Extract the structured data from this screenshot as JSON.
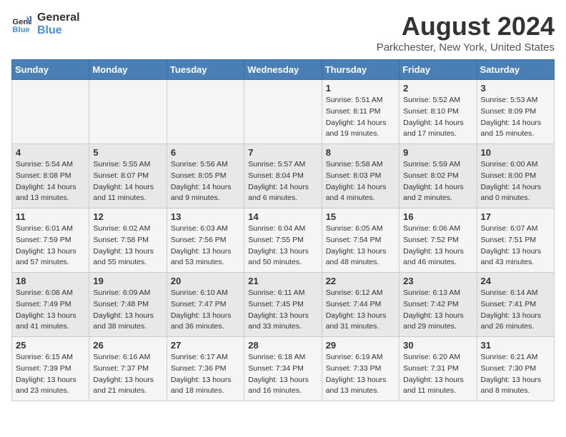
{
  "header": {
    "logo_line1": "General",
    "logo_line2": "Blue",
    "month_year": "August 2024",
    "location": "Parkchester, New York, United States"
  },
  "weekdays": [
    "Sunday",
    "Monday",
    "Tuesday",
    "Wednesday",
    "Thursday",
    "Friday",
    "Saturday"
  ],
  "weeks": [
    [
      {
        "day": "",
        "info": ""
      },
      {
        "day": "",
        "info": ""
      },
      {
        "day": "",
        "info": ""
      },
      {
        "day": "",
        "info": ""
      },
      {
        "day": "1",
        "info": "Sunrise: 5:51 AM\nSunset: 8:11 PM\nDaylight: 14 hours\nand 19 minutes."
      },
      {
        "day": "2",
        "info": "Sunrise: 5:52 AM\nSunset: 8:10 PM\nDaylight: 14 hours\nand 17 minutes."
      },
      {
        "day": "3",
        "info": "Sunrise: 5:53 AM\nSunset: 8:09 PM\nDaylight: 14 hours\nand 15 minutes."
      }
    ],
    [
      {
        "day": "4",
        "info": "Sunrise: 5:54 AM\nSunset: 8:08 PM\nDaylight: 14 hours\nand 13 minutes."
      },
      {
        "day": "5",
        "info": "Sunrise: 5:55 AM\nSunset: 8:07 PM\nDaylight: 14 hours\nand 11 minutes."
      },
      {
        "day": "6",
        "info": "Sunrise: 5:56 AM\nSunset: 8:05 PM\nDaylight: 14 hours\nand 9 minutes."
      },
      {
        "day": "7",
        "info": "Sunrise: 5:57 AM\nSunset: 8:04 PM\nDaylight: 14 hours\nand 6 minutes."
      },
      {
        "day": "8",
        "info": "Sunrise: 5:58 AM\nSunset: 8:03 PM\nDaylight: 14 hours\nand 4 minutes."
      },
      {
        "day": "9",
        "info": "Sunrise: 5:59 AM\nSunset: 8:02 PM\nDaylight: 14 hours\nand 2 minutes."
      },
      {
        "day": "10",
        "info": "Sunrise: 6:00 AM\nSunset: 8:00 PM\nDaylight: 14 hours\nand 0 minutes."
      }
    ],
    [
      {
        "day": "11",
        "info": "Sunrise: 6:01 AM\nSunset: 7:59 PM\nDaylight: 13 hours\nand 57 minutes."
      },
      {
        "day": "12",
        "info": "Sunrise: 6:02 AM\nSunset: 7:58 PM\nDaylight: 13 hours\nand 55 minutes."
      },
      {
        "day": "13",
        "info": "Sunrise: 6:03 AM\nSunset: 7:56 PM\nDaylight: 13 hours\nand 53 minutes."
      },
      {
        "day": "14",
        "info": "Sunrise: 6:04 AM\nSunset: 7:55 PM\nDaylight: 13 hours\nand 50 minutes."
      },
      {
        "day": "15",
        "info": "Sunrise: 6:05 AM\nSunset: 7:54 PM\nDaylight: 13 hours\nand 48 minutes."
      },
      {
        "day": "16",
        "info": "Sunrise: 6:06 AM\nSunset: 7:52 PM\nDaylight: 13 hours\nand 46 minutes."
      },
      {
        "day": "17",
        "info": "Sunrise: 6:07 AM\nSunset: 7:51 PM\nDaylight: 13 hours\nand 43 minutes."
      }
    ],
    [
      {
        "day": "18",
        "info": "Sunrise: 6:08 AM\nSunset: 7:49 PM\nDaylight: 13 hours\nand 41 minutes."
      },
      {
        "day": "19",
        "info": "Sunrise: 6:09 AM\nSunset: 7:48 PM\nDaylight: 13 hours\nand 38 minutes."
      },
      {
        "day": "20",
        "info": "Sunrise: 6:10 AM\nSunset: 7:47 PM\nDaylight: 13 hours\nand 36 minutes."
      },
      {
        "day": "21",
        "info": "Sunrise: 6:11 AM\nSunset: 7:45 PM\nDaylight: 13 hours\nand 33 minutes."
      },
      {
        "day": "22",
        "info": "Sunrise: 6:12 AM\nSunset: 7:44 PM\nDaylight: 13 hours\nand 31 minutes."
      },
      {
        "day": "23",
        "info": "Sunrise: 6:13 AM\nSunset: 7:42 PM\nDaylight: 13 hours\nand 29 minutes."
      },
      {
        "day": "24",
        "info": "Sunrise: 6:14 AM\nSunset: 7:41 PM\nDaylight: 13 hours\nand 26 minutes."
      }
    ],
    [
      {
        "day": "25",
        "info": "Sunrise: 6:15 AM\nSunset: 7:39 PM\nDaylight: 13 hours\nand 23 minutes."
      },
      {
        "day": "26",
        "info": "Sunrise: 6:16 AM\nSunset: 7:37 PM\nDaylight: 13 hours\nand 21 minutes."
      },
      {
        "day": "27",
        "info": "Sunrise: 6:17 AM\nSunset: 7:36 PM\nDaylight: 13 hours\nand 18 minutes."
      },
      {
        "day": "28",
        "info": "Sunrise: 6:18 AM\nSunset: 7:34 PM\nDaylight: 13 hours\nand 16 minutes."
      },
      {
        "day": "29",
        "info": "Sunrise: 6:19 AM\nSunset: 7:33 PM\nDaylight: 13 hours\nand 13 minutes."
      },
      {
        "day": "30",
        "info": "Sunrise: 6:20 AM\nSunset: 7:31 PM\nDaylight: 13 hours\nand 11 minutes."
      },
      {
        "day": "31",
        "info": "Sunrise: 6:21 AM\nSunset: 7:30 PM\nDaylight: 13 hours\nand 8 minutes."
      }
    ]
  ]
}
